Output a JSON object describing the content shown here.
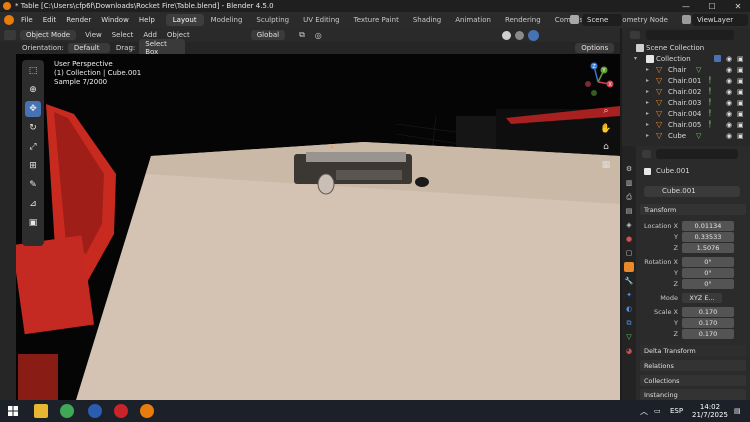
{
  "window": {
    "title": "* Table [C:\\Users\\cfp6f\\Downloads\\Rocket Fire\\Table.blend] - Blender 4.5.0",
    "minimize": "—",
    "maximize": "☐",
    "close": "✕"
  },
  "menu": [
    "File",
    "Edit",
    "Render",
    "Window",
    "Help"
  ],
  "workspaces": [
    "Layout",
    "Modeling",
    "Sculpting",
    "UV Editing",
    "Texture Paint",
    "Shading",
    "Animation",
    "Rendering",
    "Compositing",
    "Geometry Node"
  ],
  "active_workspace": "Layout",
  "scene": "Scene",
  "view_layer": "ViewLayer",
  "viewport_header": {
    "mode": "Object Mode",
    "menus": [
      "View",
      "Select",
      "Add",
      "Object"
    ],
    "transform_orientation": "Global"
  },
  "tool_header": {
    "orientation_label": "Orientation:",
    "orientation_value": "Default",
    "drag_label": "Drag:",
    "drag_value": "Select Box",
    "options": "Options"
  },
  "viewport_info": {
    "line1": "User Perspective",
    "line2": "(1) Collection | Cube.001",
    "line3": "Sample 7/2000"
  },
  "gizmo": {
    "x": "X",
    "y": "Y",
    "z": "Z"
  },
  "outliner": {
    "search_placeholder": "",
    "root": "Scene Collection",
    "collection": "Collection",
    "items": [
      "Chair",
      "Chair.001",
      "Chair.002",
      "Chair.003",
      "Chair.004",
      "Chair.005",
      "Cube"
    ]
  },
  "properties": {
    "object_name": "Cube.001",
    "data_name": "Cube.001",
    "transform_title": "Transform",
    "location": {
      "label": "Location X",
      "x": "0.01134",
      "y": "0.33533",
      "z": "1.5076"
    },
    "rotation": {
      "label": "Rotation X",
      "x": "0°",
      "y": "0°",
      "z": "0°"
    },
    "mode_label": "Mode",
    "mode_value": "XYZ E...",
    "scale": {
      "label": "Scale X",
      "x": "0.170",
      "y": "0.170",
      "z": "0.170"
    },
    "axis_y": "Y",
    "axis_z": "Z",
    "sections": [
      "Delta Transform",
      "Relations",
      "Collections",
      "Instancing"
    ]
  },
  "taskbar": {
    "language": "ESP",
    "time": "14:02",
    "date": "21/7/2025"
  }
}
